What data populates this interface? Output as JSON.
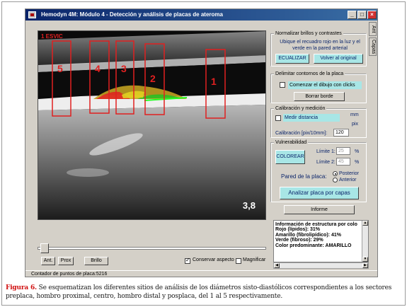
{
  "window": {
    "title": "Hemodyn 4M: Módulo 4 - Detección y análisis de placas de ateroma",
    "controls": [
      "_",
      "□",
      "×"
    ]
  },
  "side_tabs": [
    "Ant",
    "Capas"
  ],
  "ultrasound": {
    "header_label": "1 ESVIC",
    "overlay_value": "3,8",
    "sections": [
      {
        "label": "5"
      },
      {
        "label": "4"
      },
      {
        "label": "3"
      },
      {
        "label": "2"
      },
      {
        "label": "1"
      }
    ],
    "colors": {
      "section_box": "#e02020",
      "plaque_red": "#e02020",
      "plaque_yellow": "#e0d020",
      "plaque_green": "#20c020"
    }
  },
  "panel": {
    "normalize": {
      "title": "Normalizar brillos y contrastes",
      "hint": "Ubique el recuadro rojo en la luz y el verde en la pared arterial",
      "equalize_button": "ECUALIZAR",
      "restore_button": "Volver al original"
    },
    "contours": {
      "title": "Delimitar contornos de la placa",
      "draw_checkbox": "Comenzar el dibujo con clicks",
      "delete_button": "Borrar borde"
    },
    "calibration": {
      "title": "Calibración y medición",
      "measure_checkbox": "Medir distancia",
      "unit_mm": "mm",
      "unit_pix": "pix",
      "calib_label": "Calibración [pix/10mm]:",
      "calib_value": "120"
    },
    "vulnerability": {
      "title": "Vulnerabilidad",
      "color_button": "COLOREAR",
      "limit1_label": "Límite 1:",
      "limit1_value": "25",
      "limit2_label": "Límite 2:",
      "limit2_value": "45",
      "percent": "%",
      "wall_label": "Pared de la placa:",
      "posterior": "Posterior",
      "anterior": "Anterior",
      "analyze_button": "Analizar placa por capas"
    },
    "report_button": "Informe"
  },
  "info": {
    "lines": [
      "Información de estructura por colo",
      "Rojo (lípidos): 31%",
      "Amarillo (fibrolipídico): 41%",
      "Verde (fibroso): 29%",
      "Color predominante: AMARILLO"
    ]
  },
  "bottom": {
    "ant_button": "Ant.",
    "prox_button": "Prox",
    "brillo_button": "Brillo",
    "conservar_label": "Conservar aspecto",
    "magnificar_label": "Magnificar"
  },
  "status": {
    "text": "Contador de puntos de placa:5216"
  },
  "caption": {
    "label": "Figura 6.",
    "text": " Se esquematizan los diferentes sitios de análisis de los diámetros sisto-diastólicos correspondientes a los sectores preplaca, hombro proximal, centro, hombro distal y posplaca, del 1 al 5 respectivamente."
  }
}
